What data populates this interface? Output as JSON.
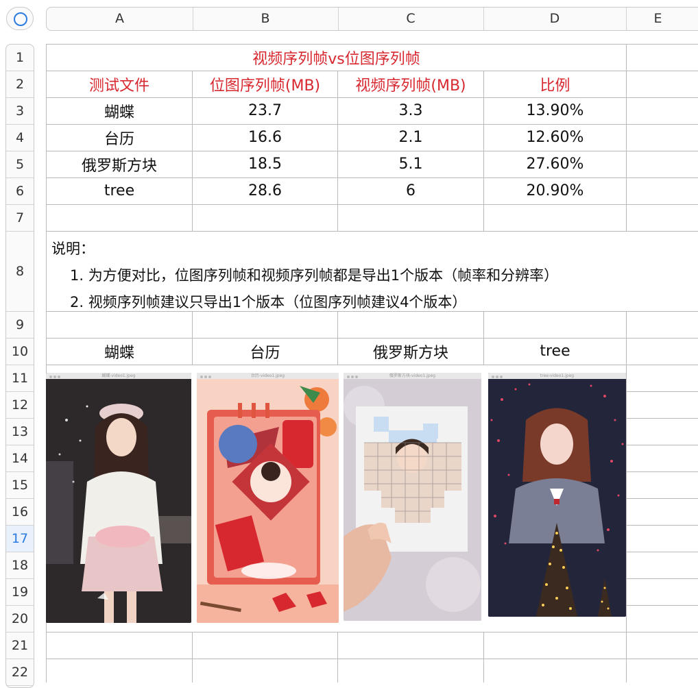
{
  "columns": [
    "A",
    "B",
    "C",
    "D",
    "E"
  ],
  "rows": [
    "1",
    "2",
    "3",
    "4",
    "5",
    "6",
    "7",
    "8",
    "9",
    "10",
    "11",
    "12",
    "13",
    "14",
    "15",
    "16",
    "17",
    "18",
    "19",
    "20",
    "21",
    "22"
  ],
  "active_row": "17",
  "sheet": {
    "title": "视频序列帧vs位图序列帧",
    "headers": [
      "测试文件",
      "位图序列帧(MB)",
      "视频序列帧(MB)",
      "比例"
    ],
    "data_rows": [
      [
        "蝴蝶",
        "23.7",
        "3.3",
        "13.90%"
      ],
      [
        "台历",
        "16.6",
        "2.1",
        "12.60%"
      ],
      [
        "俄罗斯方块",
        "18.5",
        "5.1",
        "27.60%"
      ],
      [
        "tree",
        "28.6",
        "6",
        "20.90%"
      ]
    ],
    "notes": {
      "heading": "说明：",
      "line1": "1. 为方便对比，位图序列帧和视频序列帧都是导出1个版本（帧率和分辨率）",
      "line2": "2. 视频序列帧建议只导出1个版本（位图序列帧建议4个版本）"
    },
    "image_labels": [
      "蝴蝶",
      "台历",
      "俄罗斯方块",
      "tree"
    ],
    "thumbnails": [
      {
        "caption": "蝴蝶-video1.jpeg",
        "icon": "photo-girl-beret"
      },
      {
        "caption": "台历-video1.jpeg",
        "icon": "photo-calendar-card"
      },
      {
        "caption": "俄罗斯方块-video1.jpeg",
        "icon": "photo-tetris-heart"
      },
      {
        "caption": "tree-video1.jpeg",
        "icon": "photo-fireworks-tree"
      }
    ]
  },
  "colors": {
    "accent": "#2b7be0",
    "header_red": "#d8282f",
    "grid": "#b9b9b9"
  }
}
